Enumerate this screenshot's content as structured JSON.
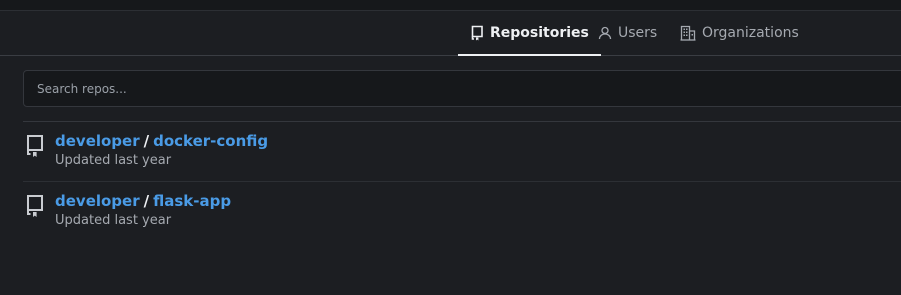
{
  "tabs": [
    {
      "label": "Repositories",
      "icon": "repo-icon",
      "active": true
    },
    {
      "label": "Users",
      "icon": "user-icon",
      "active": false
    },
    {
      "label": "Organizations",
      "icon": "organization-icon",
      "active": false
    }
  ],
  "search": {
    "placeholder": "Search repos...",
    "value": ""
  },
  "repos": [
    {
      "owner": "developer",
      "separator": "/",
      "name": "docker-config",
      "updated": "Updated last year"
    },
    {
      "owner": "developer",
      "separator": "/",
      "name": "flask-app",
      "updated": "Updated last year"
    }
  ],
  "colors": {
    "background": "#1c1e22",
    "link": "#4a9be6",
    "active_tab_underline": "#eef0f3"
  }
}
